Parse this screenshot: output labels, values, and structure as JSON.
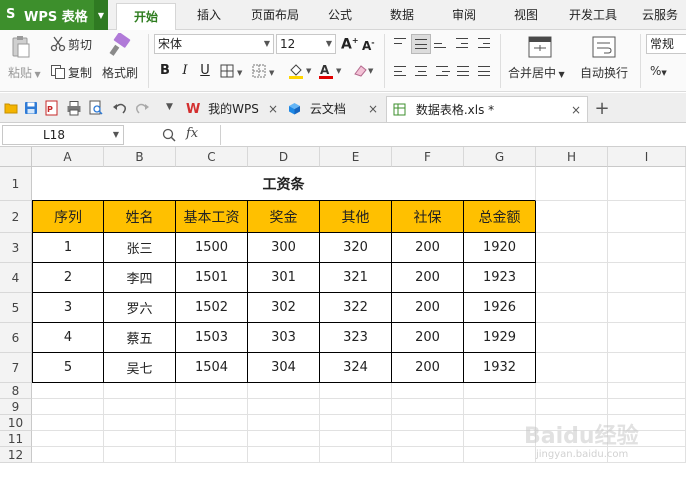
{
  "app": {
    "name": "WPS 表格",
    "logo_glyph": "S",
    "brand_color": "#3d8f2c"
  },
  "menu": {
    "tabs": [
      "开始",
      "插入",
      "页面布局",
      "公式",
      "数据",
      "审阅",
      "视图",
      "开发工具",
      "云服务"
    ],
    "active_tab": "开始"
  },
  "ribbon": {
    "paste": "粘贴",
    "cut": "剪切",
    "copy": "复制",
    "format_painter": "格式刷",
    "font_name": "宋体",
    "font_size": "12",
    "bold": "B",
    "italic": "I",
    "underline": "U",
    "merge_center": "合并居中",
    "wrap_text": "自动换行",
    "number_format": "常规",
    "percent": "%"
  },
  "quickbar": {
    "doc_tabs": [
      {
        "label": "我的WPS",
        "icon": "wps-logo-icon"
      },
      {
        "label": "云文档",
        "icon": "cloud-cube-icon"
      },
      {
        "label": "数据表格.xls *",
        "icon": "spreadsheet-icon",
        "active": true
      }
    ],
    "close_glyph": "×",
    "new_tab_glyph": "+"
  },
  "formula_bar": {
    "name_box": "L18",
    "fx_label": "fx",
    "formula": ""
  },
  "grid": {
    "columns": [
      "A",
      "B",
      "C",
      "D",
      "E",
      "F",
      "G",
      "H",
      "I"
    ],
    "rows": [
      "1",
      "2",
      "3",
      "4",
      "5",
      "6",
      "7",
      "8",
      "9",
      "10",
      "11",
      "12"
    ],
    "selected_cell": "L18"
  },
  "sheet": {
    "title": "工资条",
    "headers": [
      "序列",
      "姓名",
      "基本工资",
      "奖金",
      "其他",
      "社保",
      "总金额"
    ],
    "header_fill": "#ffc000",
    "records": [
      [
        "1",
        "张三",
        "1500",
        "300",
        "320",
        "200",
        "1920"
      ],
      [
        "2",
        "李四",
        "1501",
        "301",
        "321",
        "200",
        "1923"
      ],
      [
        "3",
        "罗六",
        "1502",
        "302",
        "322",
        "200",
        "1926"
      ],
      [
        "4",
        "蔡五",
        "1503",
        "303",
        "323",
        "200",
        "1929"
      ],
      [
        "5",
        "吴七",
        "1504",
        "304",
        "324",
        "200",
        "1932"
      ]
    ]
  },
  "watermark": {
    "text": "Baidu经验",
    "sub": "jingyan.baidu.com"
  }
}
